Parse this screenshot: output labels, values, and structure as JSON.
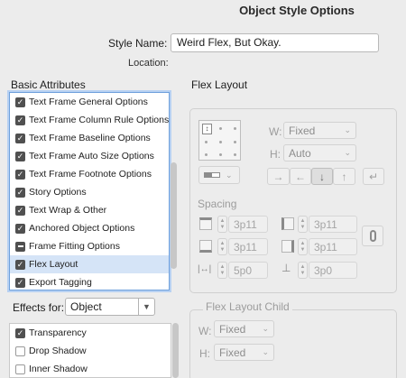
{
  "dialog": {
    "title": "Object Style Options"
  },
  "style_name": {
    "label": "Style Name:",
    "value": "Weird Flex, But Okay."
  },
  "location": {
    "label": "Location:"
  },
  "basic_attributes": {
    "title": "Basic Attributes",
    "items": [
      {
        "label": "Text Frame General Options",
        "state": "checked",
        "selected": false
      },
      {
        "label": "Text Frame Column Rule Options",
        "state": "checked",
        "selected": false
      },
      {
        "label": "Text Frame Baseline Options",
        "state": "checked",
        "selected": false
      },
      {
        "label": "Text Frame Auto Size Options",
        "state": "checked",
        "selected": false
      },
      {
        "label": "Text Frame Footnote Options",
        "state": "checked",
        "selected": false
      },
      {
        "label": "Story Options",
        "state": "checked",
        "selected": false
      },
      {
        "label": "Text Wrap & Other",
        "state": "checked",
        "selected": false
      },
      {
        "label": "Anchored Object Options",
        "state": "checked",
        "selected": false
      },
      {
        "label": "Frame Fitting Options",
        "state": "mixed",
        "selected": false
      },
      {
        "label": "Flex Layout",
        "state": "checked",
        "selected": true
      },
      {
        "label": "Export Tagging",
        "state": "checked",
        "selected": false
      }
    ]
  },
  "effects": {
    "label": "Effects for:",
    "selected": "Object",
    "items": [
      {
        "label": "Transparency",
        "state": "checked"
      },
      {
        "label": "Drop Shadow",
        "state": "empty"
      },
      {
        "label": "Inner Shadow",
        "state": "empty"
      }
    ]
  },
  "flex_layout": {
    "title": "Flex Layout",
    "width": {
      "label": "W:",
      "value": "Fixed"
    },
    "height": {
      "label": "H:",
      "value": "Auto"
    },
    "direction_buttons": [
      {
        "icon": "arrow-right-icon",
        "glyph": "→",
        "active": false
      },
      {
        "icon": "arrow-left-icon",
        "glyph": "←",
        "active": false
      },
      {
        "icon": "arrow-down-icon",
        "glyph": "↓",
        "active": true
      },
      {
        "icon": "arrow-up-icon",
        "glyph": "↑",
        "active": false
      }
    ],
    "wrap_glyph": "↵",
    "spacing": {
      "title": "Spacing",
      "top": "3p11",
      "left": "3p11",
      "bottom": "3p11",
      "right": "3p11",
      "horizontal_gap": "5p0",
      "vertical_gap": "3p0"
    }
  },
  "flex_layout_child": {
    "title": "Flex Layout Child",
    "width": {
      "label": "W:",
      "value": "Fixed"
    },
    "height": {
      "label": "H:",
      "value": "Fixed"
    }
  },
  "colors": {
    "selection": "#d5e4f7",
    "focus": "#6fa0dc",
    "checkbox": "#505050"
  }
}
